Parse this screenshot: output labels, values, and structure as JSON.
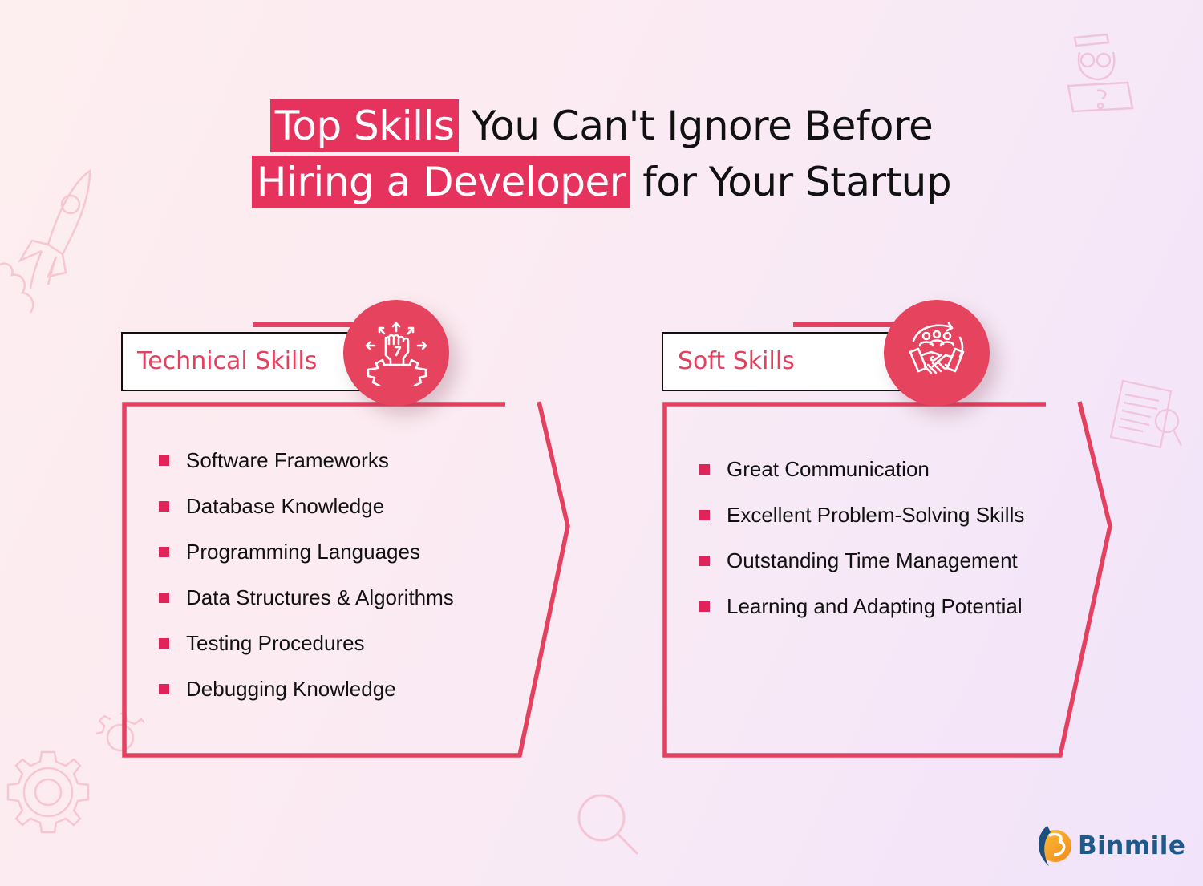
{
  "title": {
    "line1_highlight": "Top Skills",
    "line1_rest": "You Can't Ignore Before",
    "line2_highlight": "Hiring a Developer",
    "line2_rest": "for Your Startup"
  },
  "colors": {
    "accent": "#e6335e",
    "bullet": "#e0245a",
    "heading_text": "#e3415f",
    "body_text": "#111111"
  },
  "panels": [
    {
      "heading": "Technical Skills",
      "icon": "fist-gear-icon",
      "items": [
        "Software Frameworks",
        "Database Knowledge",
        "Programming Languages",
        "Data Structures & Algorithms",
        "Testing Procedures",
        "Debugging Knowledge"
      ]
    },
    {
      "heading": "Soft Skills",
      "icon": "team-handshake-icon",
      "items": [
        "Great Communication",
        "Excellent Problem-Solving Skills",
        "Outstanding Time Management",
        "Learning and Adapting Potential"
      ]
    }
  ],
  "decorations": [
    "rocket-icon",
    "developer-laptop-icon",
    "document-search-icon",
    "gears-icon",
    "magnifier-icon"
  ],
  "logo": {
    "text": "Binmile",
    "icon": "binmile-logo-icon"
  }
}
